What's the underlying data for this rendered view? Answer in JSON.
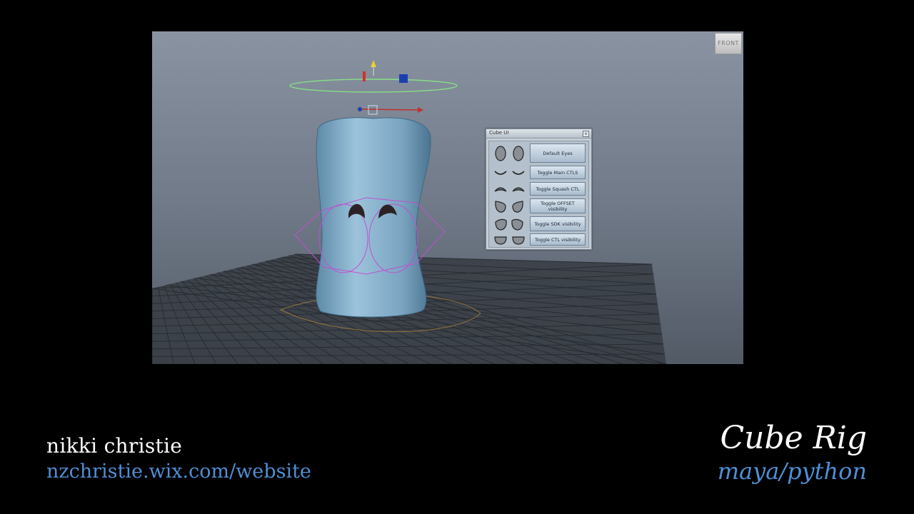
{
  "viewport": {
    "viewcube_label": "FRONT"
  },
  "cube_ui": {
    "title": "Cube UI",
    "close_label": "x",
    "buttons": [
      {
        "label": "Default Eyes",
        "eye_icon": "oval-eye-icon"
      },
      {
        "label": "Toggle Main CTLS",
        "eye_icon": "closed-eye-icon"
      },
      {
        "label": "Toggle Squash CTL",
        "eye_icon": "arched-eye-icon"
      },
      {
        "label": "Toggle OFFSET visibility",
        "eye_icon": "droop-eye-icon"
      },
      {
        "label": "Toggle SDK visibility",
        "eye_icon": "sad-eye-icon"
      },
      {
        "label": "Toggle CTL visibility",
        "eye_icon": "half-eye-icon"
      }
    ]
  },
  "credits": {
    "author": "nikki christie",
    "website": "nzchristie.wix.com/website"
  },
  "brand": {
    "title": "Cube Rig",
    "subtitle": "maya/python"
  },
  "colors": {
    "background": "#000000",
    "link": "#4f8fd6",
    "rig_curve": "#c050d0",
    "control_circle": "#7fd07f",
    "mesh": "#7fa8c4"
  }
}
